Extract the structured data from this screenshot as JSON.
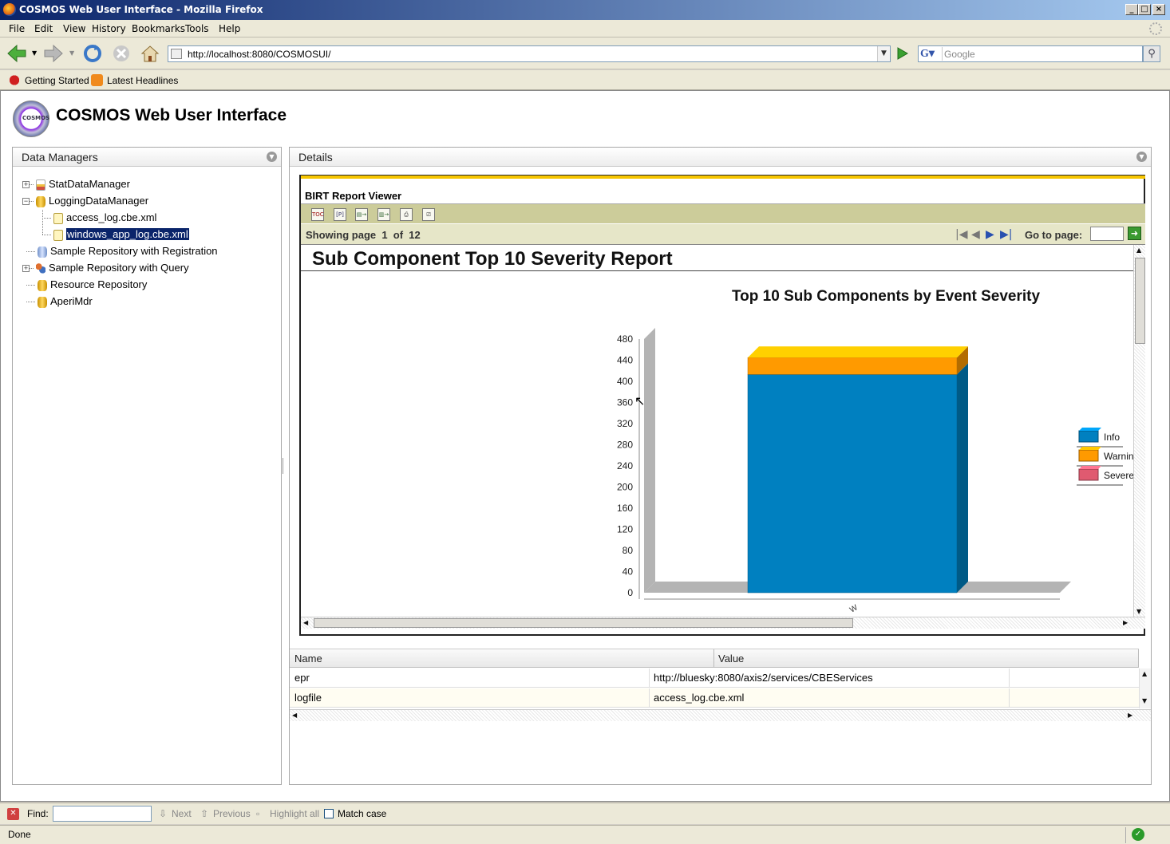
{
  "window": {
    "title": "COSMOS Web User Interface - Mozilla Firefox"
  },
  "menu": [
    "File",
    "Edit",
    "View",
    "History",
    "Bookmarks",
    "Tools",
    "Help"
  ],
  "nav": {
    "url": "http://localhost:8080/COSMOSUI/",
    "search_placeholder": "Google"
  },
  "bookmarks": [
    "Getting Started",
    "Latest Headlines"
  ],
  "app": {
    "title": "COSMOS Web User Interface",
    "logo_text": "COSMOS"
  },
  "left_panel": {
    "title": "Data Managers",
    "tree": [
      {
        "label": "StatDataManager",
        "icon": "chart-icon",
        "expander": "+"
      },
      {
        "label": "LoggingDataManager",
        "icon": "database-icon",
        "expander": "-"
      },
      {
        "label": "access_log.cbe.xml",
        "icon": "file-icon",
        "child": true
      },
      {
        "label": "windows_app_log.cbe.xml",
        "icon": "file-icon",
        "child": true,
        "selected": true
      },
      {
        "label": "Sample Repository with Registration",
        "icon": "repository-icon"
      },
      {
        "label": "Sample Repository with Query",
        "icon": "people-icon",
        "expander": "+"
      },
      {
        "label": "Resource Repository",
        "icon": "database-icon"
      },
      {
        "label": "AperiMdr",
        "icon": "database-icon"
      }
    ]
  },
  "right_panel": {
    "title": "Details"
  },
  "birt": {
    "title": "BIRT Report Viewer",
    "page_info": "Showing page  1  of  12",
    "goto_label": "Go to page:",
    "report_title": "Sub Component Top 10 Severity Report"
  },
  "chart_data": {
    "type": "bar",
    "title": "Top 10 Sub Components by Event Severity",
    "stacked": true,
    "categories": [
      ""
    ],
    "series": [
      {
        "name": "Info",
        "values": [
          413
        ],
        "color": "#0080c0"
      },
      {
        "name": "Warning",
        "values": [
          32
        ],
        "color": "#ff9a00"
      },
      {
        "name": "Severe",
        "values": [
          0
        ],
        "color": "#e05a70"
      }
    ],
    "legend_visible": [
      "Info",
      "Warnin",
      "Severe"
    ],
    "yticks": [
      "0",
      "40",
      "80",
      "120",
      "160",
      "200",
      "240",
      "280",
      "320",
      "360",
      "400",
      "440",
      "480"
    ],
    "ylim": [
      0,
      480
    ],
    "grid": false,
    "legend_position": "right"
  },
  "properties": {
    "headers": [
      "Name",
      "Value"
    ],
    "rows": [
      {
        "name": "epr",
        "value": "http://bluesky:8080/axis2/services/CBEServices"
      },
      {
        "name": "logfile",
        "value": "access_log.cbe.xml"
      }
    ]
  },
  "findbar": {
    "label": "Find:",
    "next": "Next",
    "previous": "Previous",
    "highlight": "Highlight all",
    "match_case": "Match case"
  },
  "status": "Done"
}
